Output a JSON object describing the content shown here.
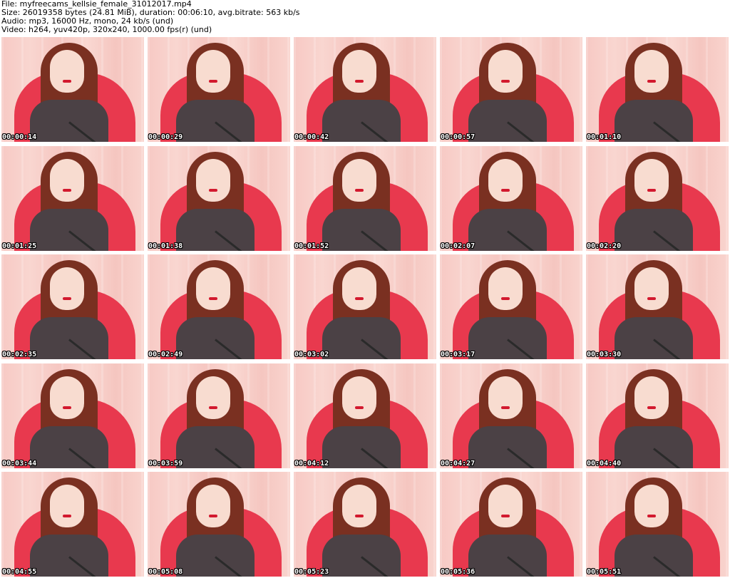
{
  "header": {
    "file_line": "File: myfreecams_kellsie_female_31012017.mp4",
    "size_line": "Size: 26019358 bytes (24.81 MiB), duration: 00:06:10, avg.bitrate: 563 kb/s",
    "audio_line": "Audio: mp3, 16000 Hz, mono, 24 kb/s (und)",
    "video_line": "Video: h264, yuv420p, 320x240, 1000.00 fps(r) (und)"
  },
  "thumbnails": [
    {
      "timestamp": "00:00:14"
    },
    {
      "timestamp": "00:00:29"
    },
    {
      "timestamp": "00:00:42"
    },
    {
      "timestamp": "00:00:57"
    },
    {
      "timestamp": "00:01:10"
    },
    {
      "timestamp": "00:01:25"
    },
    {
      "timestamp": "00:01:38"
    },
    {
      "timestamp": "00:01:52"
    },
    {
      "timestamp": "00:02:07"
    },
    {
      "timestamp": "00:02:20"
    },
    {
      "timestamp": "00:02:35"
    },
    {
      "timestamp": "00:02:49"
    },
    {
      "timestamp": "00:03:02"
    },
    {
      "timestamp": "00:03:17"
    },
    {
      "timestamp": "00:03:30"
    },
    {
      "timestamp": "00:03:44"
    },
    {
      "timestamp": "00:03:59"
    },
    {
      "timestamp": "00:04:12"
    },
    {
      "timestamp": "00:04:27"
    },
    {
      "timestamp": "00:04:40"
    },
    {
      "timestamp": "00:04:55"
    },
    {
      "timestamp": "00:05:08"
    },
    {
      "timestamp": "00:05:23"
    },
    {
      "timestamp": "00:05:36"
    },
    {
      "timestamp": "00:05:51"
    }
  ],
  "colors": {
    "background": "#ffffff",
    "header_text": "#000000",
    "timestamp_text": "#ffffff",
    "timestamp_outline": "#000000",
    "chair": "#e8394e",
    "wall": "#f7c9c4"
  }
}
